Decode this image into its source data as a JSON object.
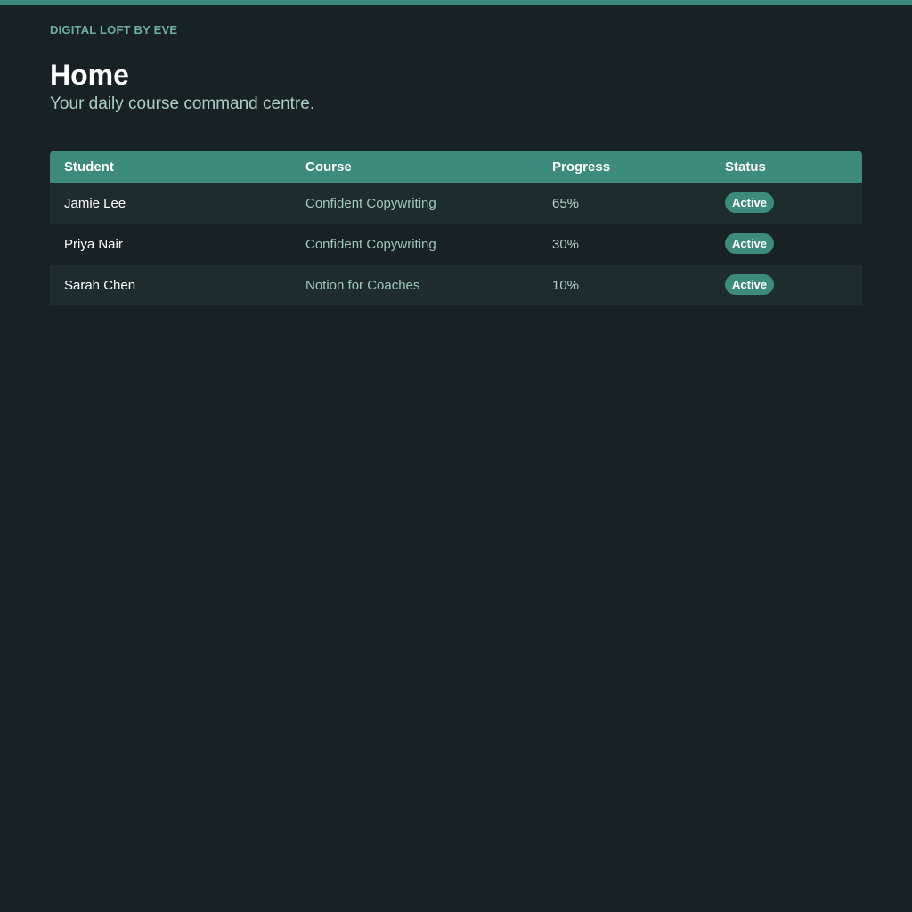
{
  "app": {
    "brand": "DIGITAL LOFT BY EVE",
    "accent_color": "#3d8b7d",
    "background_color": "#182123"
  },
  "header": {
    "title": "Home",
    "subtitle": "Your daily course command centre."
  },
  "table": {
    "columns": [
      "Student",
      "Course",
      "Progress",
      "Status"
    ],
    "rows": [
      {
        "student": "Jamie Lee",
        "course": "Confident Copywriting",
        "progress": "65%",
        "status": "Active"
      },
      {
        "student": "Priya Nair",
        "course": "Confident Copywriting",
        "progress": "30%",
        "status": "Active"
      },
      {
        "student": "Sarah Chen",
        "course": "Notion for Coaches",
        "progress": "10%",
        "status": "Active"
      }
    ]
  }
}
